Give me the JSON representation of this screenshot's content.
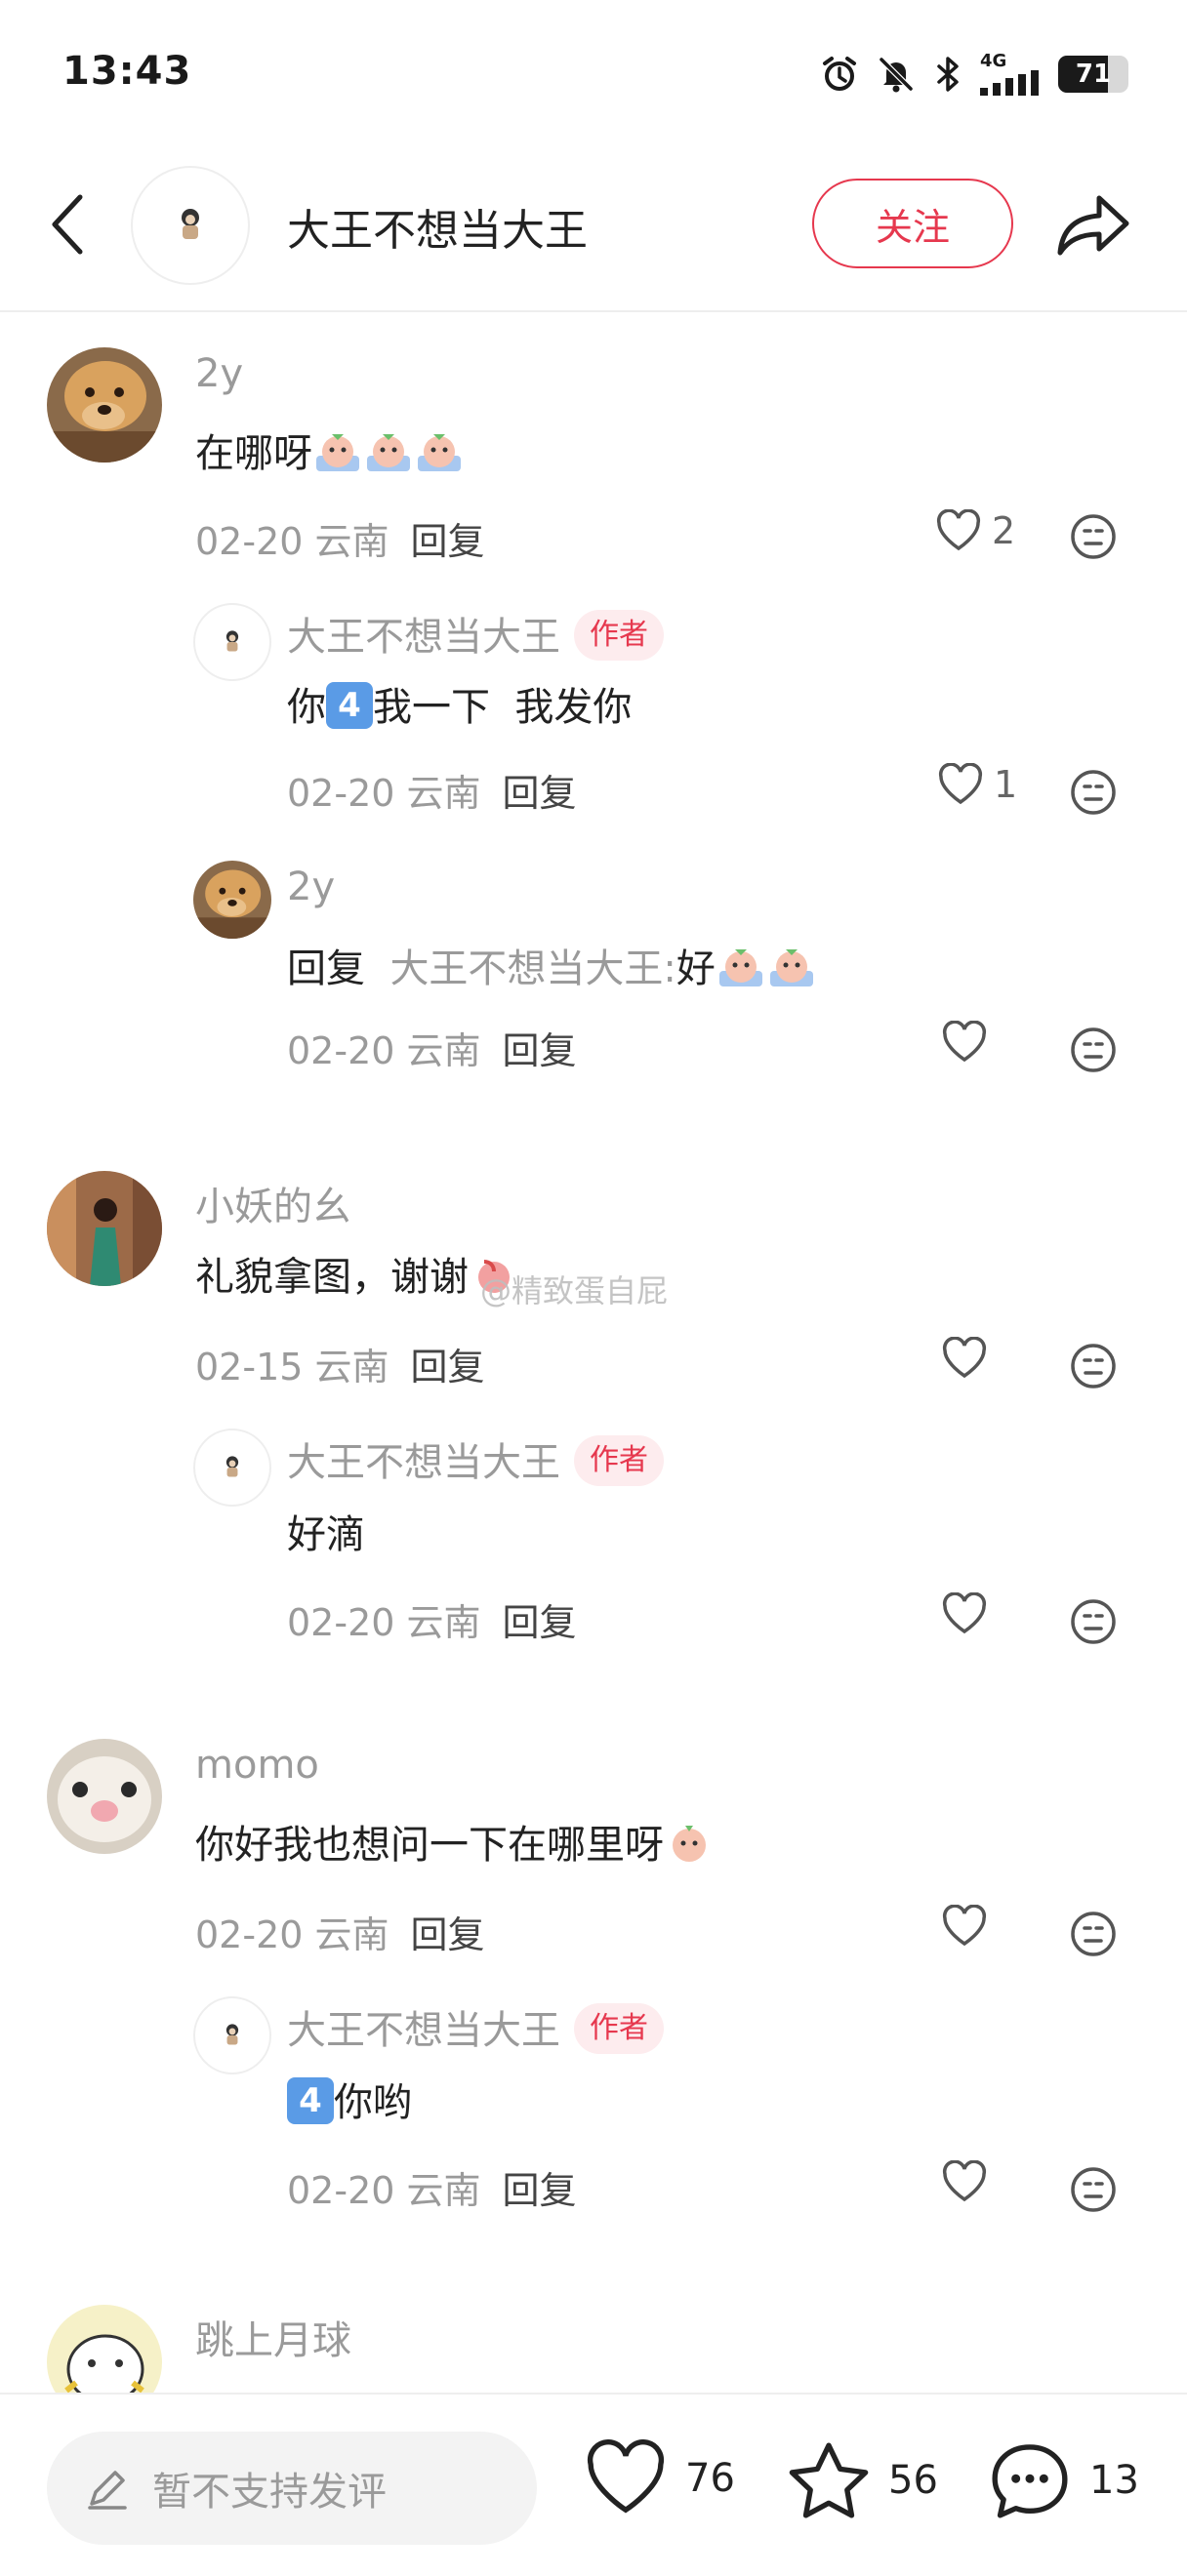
{
  "status_bar": {
    "time": "13:43",
    "network": "4G",
    "battery": 71,
    "icons": [
      "alarm-icon",
      "mute-bell-icon",
      "bluetooth-icon",
      "signal-icon",
      "battery-icon"
    ]
  },
  "header": {
    "title": "大王不想当大王",
    "follow_label": "关注",
    "icons": [
      "back-arrow-icon",
      "share-icon"
    ]
  },
  "comments": [
    {
      "user": "2y",
      "text": "在哪呀",
      "date": "02-20 云南",
      "reply_label": "回复",
      "likes": "2",
      "replies": [
        {
          "user": "大王不想当大王",
          "badge": "作者",
          "text_before": "你",
          "kbd": "4",
          "text_after": "我一下  我发你",
          "date": "02-20 云南",
          "reply_label": "回复",
          "likes": "1"
        },
        {
          "user": "2y",
          "reply_prefix": "回复",
          "reply_target": "大王不想当大王:",
          "text": "好",
          "date": "02-20 云南",
          "reply_label": "回复",
          "likes": ""
        }
      ]
    },
    {
      "user": "小妖的幺",
      "text": "礼貌拿图，谢谢",
      "date": "02-15 云南",
      "reply_label": "回复",
      "likes": "",
      "replies": [
        {
          "user": "大王不想当大王",
          "badge": "作者",
          "text": "好滴",
          "date": "02-20 云南",
          "reply_label": "回复",
          "likes": ""
        }
      ]
    },
    {
      "user": "momo",
      "text": "你好我也想问一下在哪里呀",
      "date": "02-20 云南",
      "reply_label": "回复",
      "likes": "",
      "replies": [
        {
          "user": "大王不想当大王",
          "badge": "作者",
          "kbd": "4",
          "text_after": "你哟",
          "date": "02-20 云南",
          "reply_label": "回复",
          "likes": ""
        }
      ]
    },
    {
      "user": "跳上月球"
    }
  ],
  "watermark": "@精致蛋自屁",
  "bottom_bar": {
    "input_placeholder": "暂不支持发评",
    "likes": "76",
    "favorites": "56",
    "comments": "13"
  },
  "colors": {
    "accent": "#e6384e",
    "muted": "#9a9a9a",
    "badge_bg": "#fdecee"
  }
}
